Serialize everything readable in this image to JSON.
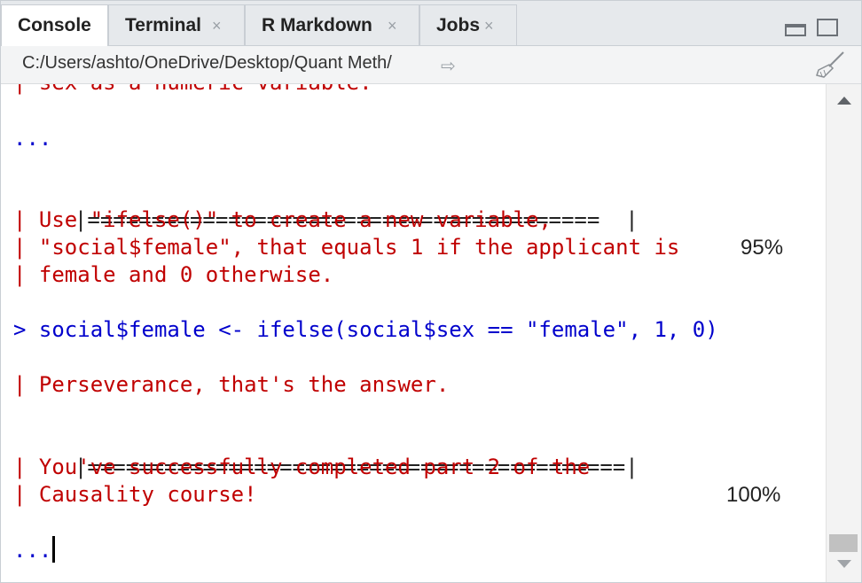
{
  "tabs": [
    {
      "label": "Console",
      "active": true,
      "closable": false
    },
    {
      "label": "Terminal",
      "closable": true
    },
    {
      "label": "R Markdown",
      "closable": true
    },
    {
      "label": "Jobs",
      "closable": true
    }
  ],
  "close_glyph": "×",
  "path": {
    "text": "C:/Users/ashto/OneDrive/Desktop/Quant Meth/",
    "go_icon": "⇨"
  },
  "console": {
    "lines": {
      "l0": "| sex as a numeric variable.",
      "l1": "...",
      "l2_bar": "  |========================================  |",
      "l2_pct": "95%",
      "l3": "| Use \"ifelse()\" to create a new variable,",
      "l4": "| \"social$female\", that equals 1 if the applicant is",
      "l5": "| female and 0 otherwise.",
      "l6": "> social$female <- ifelse(social$sex == \"female\", 1, 0)",
      "l7": "| Perseverance, that's the answer.",
      "l8_bar": "  |==========================================|",
      "l8_pct": "100%",
      "l9": "| You've successfully completed part 2 of the",
      "l10": "| Causality course!",
      "l11": "..."
    }
  },
  "colors": {
    "message": "#c00000",
    "input": "#0000cc"
  }
}
